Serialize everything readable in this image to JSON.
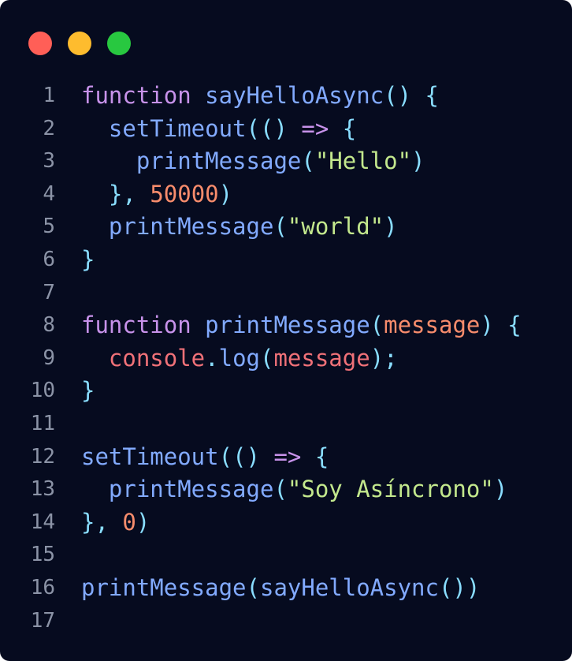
{
  "window_controls": {
    "close_color": "#ff5f57",
    "minimize_color": "#febc2e",
    "maximize_color": "#28c840"
  },
  "colors": {
    "keyword": "#c792ea",
    "function": "#82aaff",
    "punctuation": "#89ddff",
    "string": "#c3e88d",
    "number": "#f78c6c",
    "parameter": "#f78c6c",
    "variable": "#f07178",
    "plain": "#82aaff"
  },
  "code": {
    "language": "javascript",
    "lines": [
      {
        "number": "1",
        "tokens": [
          {
            "t": "function",
            "k": "keyword"
          },
          {
            "t": " ",
            "k": "plain"
          },
          {
            "t": "sayHelloAsync",
            "k": "function"
          },
          {
            "t": "() {",
            "k": "punctuation"
          }
        ]
      },
      {
        "number": "2",
        "tokens": [
          {
            "t": "  ",
            "k": "plain"
          },
          {
            "t": "setTimeout",
            "k": "function"
          },
          {
            "t": "((",
            "k": "punctuation"
          },
          {
            "t": ") ",
            "k": "punctuation"
          },
          {
            "t": "=>",
            "k": "keyword"
          },
          {
            "t": " {",
            "k": "punctuation"
          }
        ]
      },
      {
        "number": "3",
        "tokens": [
          {
            "t": "    ",
            "k": "plain"
          },
          {
            "t": "printMessage",
            "k": "function"
          },
          {
            "t": "(",
            "k": "punctuation"
          },
          {
            "t": "\"Hello\"",
            "k": "string"
          },
          {
            "t": ")",
            "k": "punctuation"
          }
        ]
      },
      {
        "number": "4",
        "tokens": [
          {
            "t": "  ",
            "k": "plain"
          },
          {
            "t": "}, ",
            "k": "punctuation"
          },
          {
            "t": "50000",
            "k": "number"
          },
          {
            "t": ")",
            "k": "punctuation"
          }
        ]
      },
      {
        "number": "5",
        "tokens": [
          {
            "t": "  ",
            "k": "plain"
          },
          {
            "t": "printMessage",
            "k": "function"
          },
          {
            "t": "(",
            "k": "punctuation"
          },
          {
            "t": "\"world\"",
            "k": "string"
          },
          {
            "t": ")",
            "k": "punctuation"
          }
        ]
      },
      {
        "number": "6",
        "tokens": [
          {
            "t": "}",
            "k": "punctuation"
          }
        ]
      },
      {
        "number": "7",
        "tokens": []
      },
      {
        "number": "8",
        "tokens": [
          {
            "t": "function",
            "k": "keyword"
          },
          {
            "t": " ",
            "k": "plain"
          },
          {
            "t": "printMessage",
            "k": "function"
          },
          {
            "t": "(",
            "k": "punctuation"
          },
          {
            "t": "message",
            "k": "parameter"
          },
          {
            "t": ") {",
            "k": "punctuation"
          }
        ]
      },
      {
        "number": "9",
        "tokens": [
          {
            "t": "  ",
            "k": "plain"
          },
          {
            "t": "console",
            "k": "variable"
          },
          {
            "t": ".",
            "k": "punctuation"
          },
          {
            "t": "log",
            "k": "function"
          },
          {
            "t": "(",
            "k": "punctuation"
          },
          {
            "t": "message",
            "k": "variable"
          },
          {
            "t": ");",
            "k": "punctuation"
          }
        ]
      },
      {
        "number": "10",
        "tokens": [
          {
            "t": "}",
            "k": "punctuation"
          }
        ]
      },
      {
        "number": "11",
        "tokens": []
      },
      {
        "number": "12",
        "tokens": [
          {
            "t": "setTimeout",
            "k": "function"
          },
          {
            "t": "((",
            "k": "punctuation"
          },
          {
            "t": ") ",
            "k": "punctuation"
          },
          {
            "t": "=>",
            "k": "keyword"
          },
          {
            "t": " {",
            "k": "punctuation"
          }
        ]
      },
      {
        "number": "13",
        "tokens": [
          {
            "t": "  ",
            "k": "plain"
          },
          {
            "t": "printMessage",
            "k": "function"
          },
          {
            "t": "(",
            "k": "punctuation"
          },
          {
            "t": "\"Soy Asíncrono\"",
            "k": "string"
          },
          {
            "t": ")",
            "k": "punctuation"
          }
        ]
      },
      {
        "number": "14",
        "tokens": [
          {
            "t": "}, ",
            "k": "punctuation"
          },
          {
            "t": "0",
            "k": "number"
          },
          {
            "t": ")",
            "k": "punctuation"
          }
        ]
      },
      {
        "number": "15",
        "tokens": []
      },
      {
        "number": "16",
        "tokens": [
          {
            "t": "printMessage",
            "k": "function"
          },
          {
            "t": "(",
            "k": "punctuation"
          },
          {
            "t": "sayHelloAsync",
            "k": "function"
          },
          {
            "t": "())",
            "k": "punctuation"
          }
        ]
      },
      {
        "number": "17",
        "tokens": []
      }
    ]
  }
}
